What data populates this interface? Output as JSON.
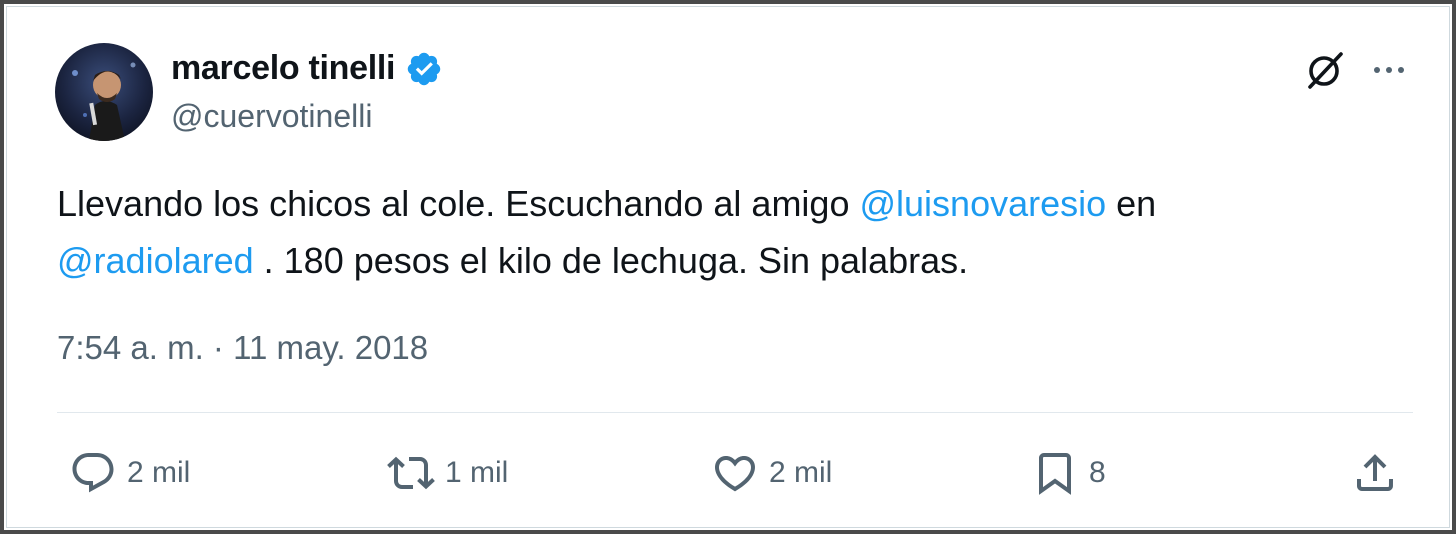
{
  "tweet": {
    "author": {
      "display_name": "marcelo tinelli",
      "handle": "@cuervotinelli",
      "verified": true
    },
    "text_segments": [
      {
        "text": "Llevando los chicos al cole. Escuchando al amigo ",
        "type": "text"
      },
      {
        "text": "@luisnovaresio",
        "type": "mention"
      },
      {
        "text": " en ",
        "type": "text"
      },
      {
        "text": "@radiolared",
        "type": "mention"
      },
      {
        "text": " . 180 pesos el kilo de lechuga. Sin palabras.",
        "type": "text"
      }
    ],
    "timestamp": "7:54 a. m. · 11 may. 2018"
  },
  "actions": {
    "reply": {
      "icon": "reply-icon",
      "count": "2 mil"
    },
    "retweet": {
      "icon": "retweet-icon",
      "count": "1 mil"
    },
    "like": {
      "icon": "heart-icon",
      "count": "2 mil"
    },
    "bookmark": {
      "icon": "bookmark-icon",
      "count": "8"
    },
    "share": {
      "icon": "share-icon"
    }
  },
  "header_icons": {
    "grok": "grok-icon",
    "more": "more-icon"
  },
  "colors": {
    "text": "#0f1419",
    "secondary": "#536471",
    "accent": "#1d9bf0"
  }
}
